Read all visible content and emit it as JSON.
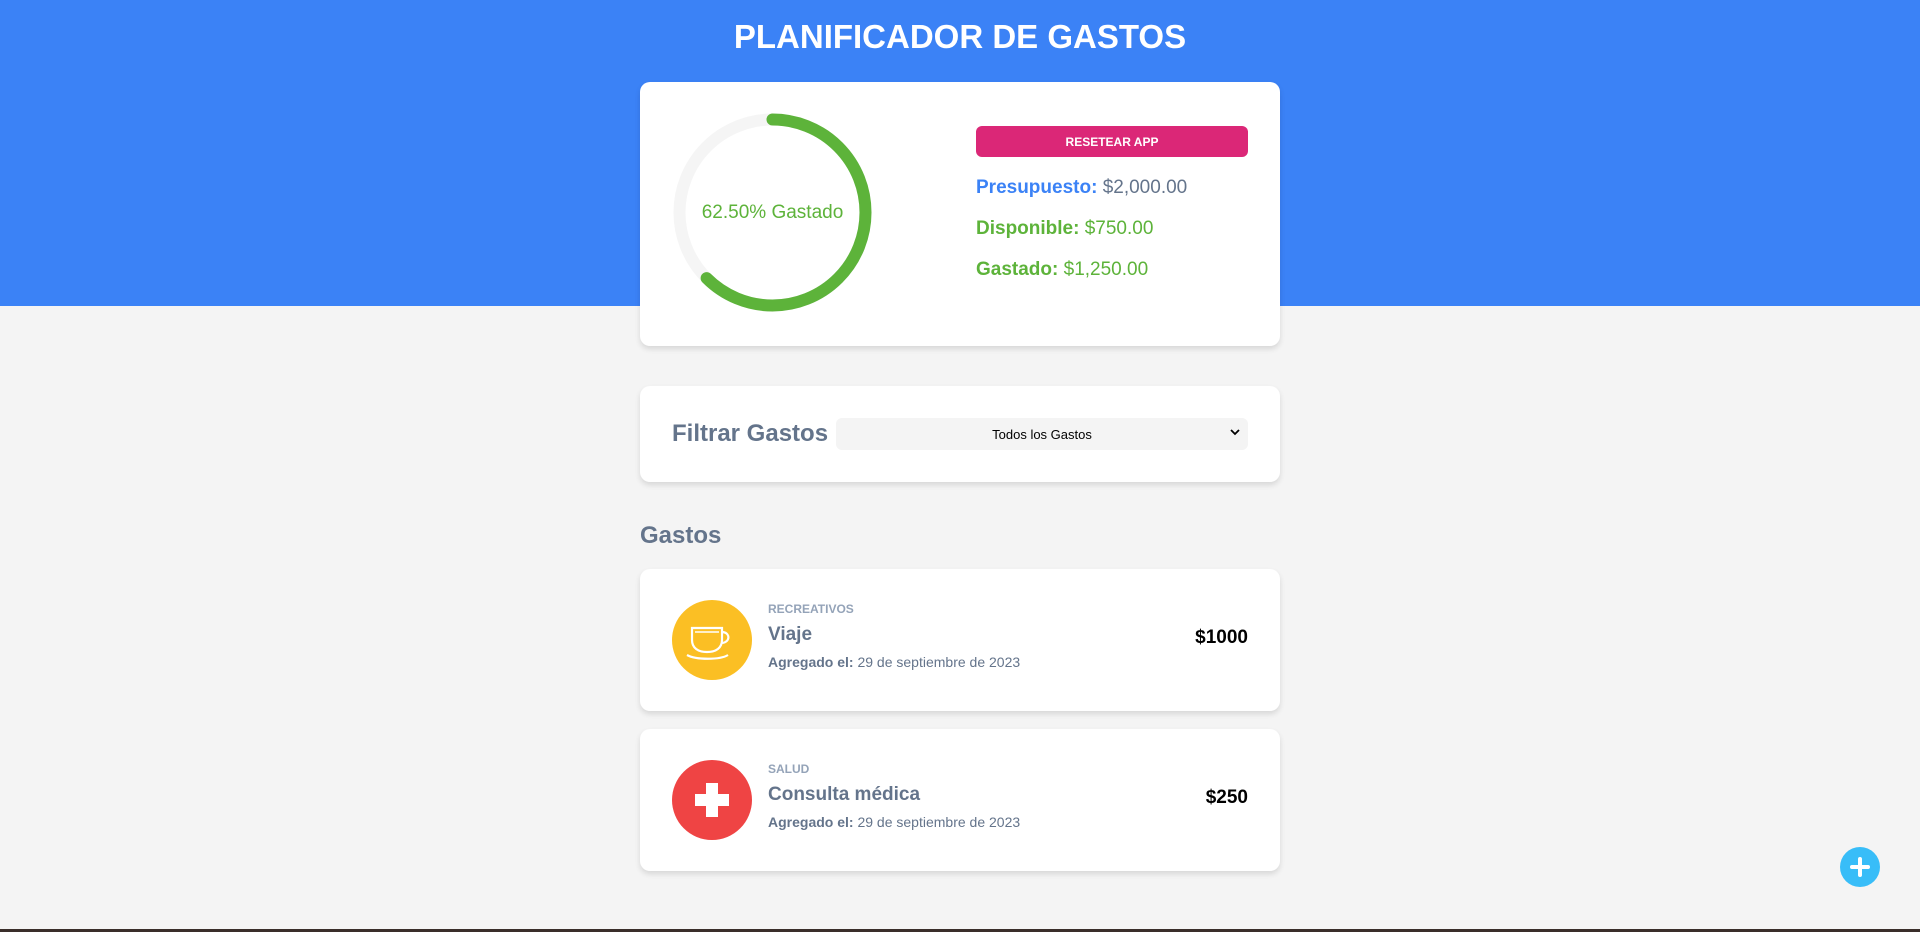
{
  "app": {
    "title": "PLANIFICADOR DE GASTOS"
  },
  "budget": {
    "progress_percent": 62.5,
    "progress_text": "62.50% Gastado",
    "reset_label": "RESETEAR APP",
    "presupuesto_label": "Presupuesto:",
    "presupuesto_value": "$2,000.00",
    "disponible_label": "Disponible:",
    "disponible_value": "$750.00",
    "gastado_label": "Gastado:",
    "gastado_value": "$1,250.00"
  },
  "filter": {
    "label": "Filtrar Gastos",
    "selected": "Todos los Gastos"
  },
  "expenses_section": {
    "title": "Gastos"
  },
  "expenses": [
    {
      "category": "RECREATIVOS",
      "name": "Viaje",
      "date_label": "Agregado el:",
      "date": "29 de septiembre de 2023",
      "amount": "$1000",
      "icon": "teacup-icon"
    },
    {
      "category": "SALUD",
      "name": "Consulta médica",
      "date_label": "Agregado el:",
      "date": "29 de septiembre de 2023",
      "amount": "$250",
      "icon": "medical-cross-icon"
    }
  ],
  "colors": {
    "header": "#3b82f6",
    "reset_button": "#db2777",
    "ring_progress": "#5db33a",
    "ring_track": "#f5f5f5",
    "fab": "#38bdf8"
  }
}
